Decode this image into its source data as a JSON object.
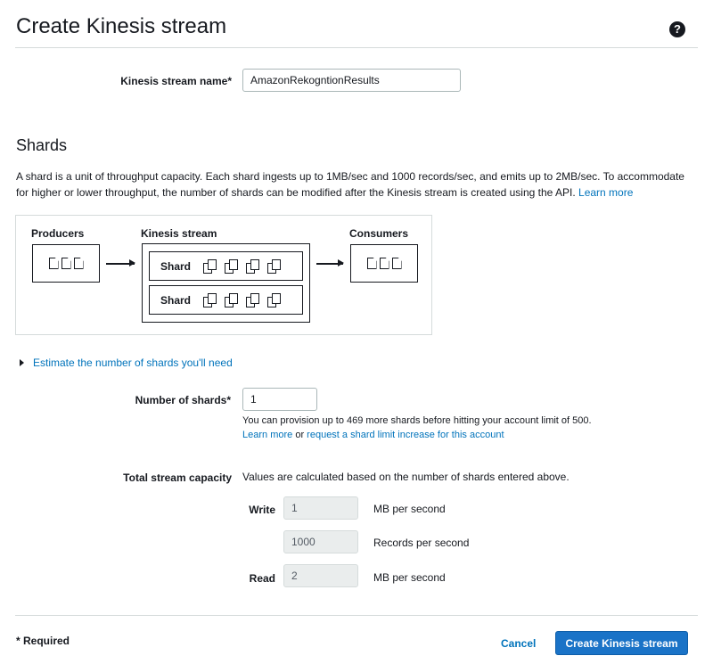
{
  "page": {
    "title": "Create Kinesis stream"
  },
  "stream_name": {
    "label": "Kinesis stream name*",
    "value": "AmazonRekogntionResults"
  },
  "shards_section": {
    "title": "Shards",
    "description": "A shard is a unit of throughput capacity. Each shard ingests up to 1MB/sec and 1000 records/sec, and emits up to 2MB/sec. To accommodate for higher or lower throughput, the number of shards can be modified after the Kinesis stream is created using the API.",
    "learn_more": "Learn more"
  },
  "diagram": {
    "producers": "Producers",
    "stream": "Kinesis stream",
    "consumers": "Consumers",
    "shards": [
      "Shard",
      "Shard"
    ]
  },
  "estimate_link": "Estimate the number of shards you'll need",
  "num_shards": {
    "label": "Number of shards*",
    "value": "1",
    "help": "You can provision up to 469 more shards before hitting your account limit of 500.",
    "learn_more": "Learn more",
    "or": "or",
    "request_link": "request a shard limit increase for this account"
  },
  "capacity": {
    "label": "Total stream capacity",
    "note": "Values are calculated based on the number of shards entered above.",
    "write_label": "Write",
    "write_mb": "1",
    "write_mb_unit": "MB per second",
    "records": "1000",
    "records_unit": "Records per second",
    "read_label": "Read",
    "read_mb": "2",
    "read_mb_unit": "MB per second"
  },
  "footer": {
    "required": "* Required",
    "cancel": "Cancel",
    "create": "Create Kinesis stream"
  }
}
